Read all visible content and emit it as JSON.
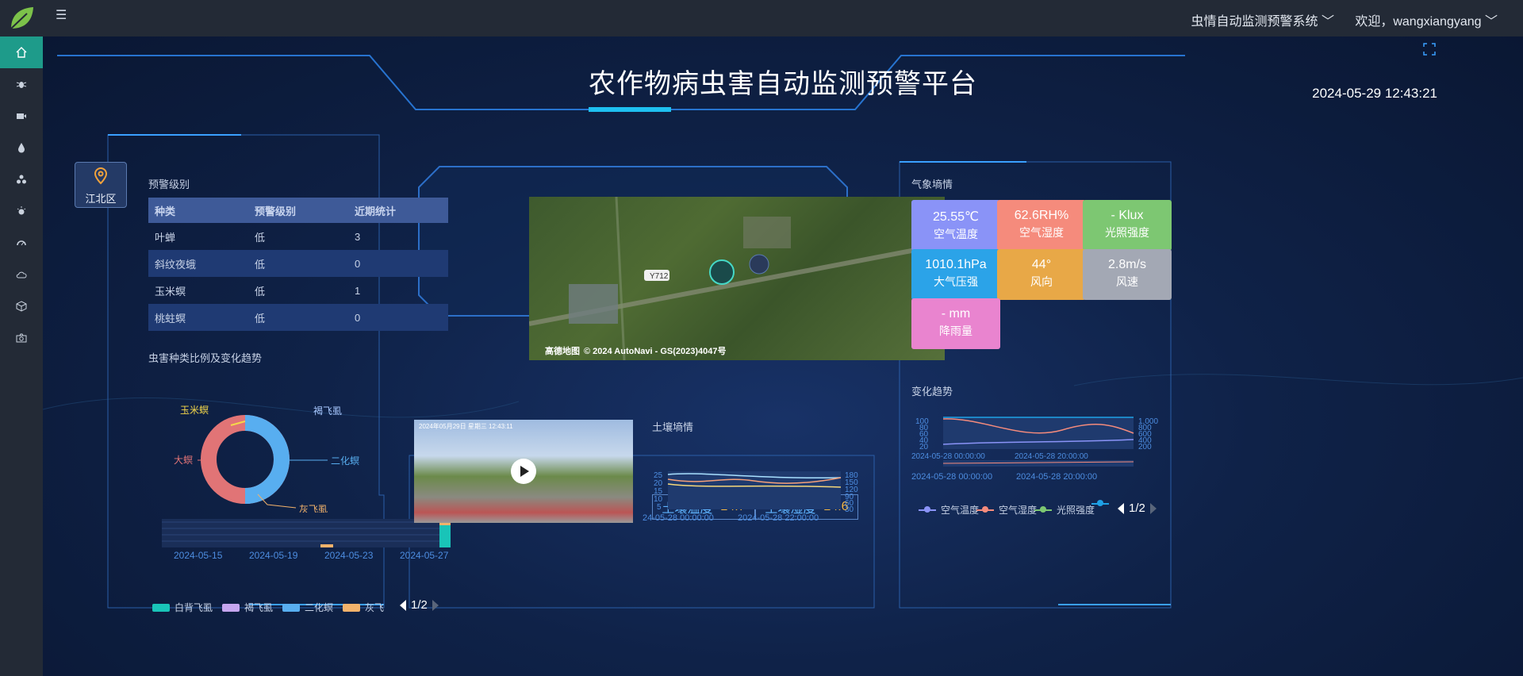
{
  "header": {
    "system_name": "虫情自动监测预警系统 ﹀",
    "welcome": "欢迎，wangxiangyang ﹀"
  },
  "page": {
    "title": "农作物病虫害自动监测预警平台",
    "datetime": "2024-05-29 12:43:21"
  },
  "location": {
    "label": "江北区"
  },
  "warning": {
    "title": "预警级别",
    "columns": [
      "种类",
      "预警级别",
      "近期统计"
    ],
    "rows": [
      {
        "name": "叶蝉",
        "level": "低",
        "count": "3"
      },
      {
        "name": "斜纹夜蛾",
        "level": "低",
        "count": "0"
      },
      {
        "name": "玉米螟",
        "level": "低",
        "count": "1"
      },
      {
        "name": "桃蛀螟",
        "level": "低",
        "count": "0"
      }
    ]
  },
  "pest_chart": {
    "title": "虫害种类比例及变化趋势",
    "legend": [
      "白背飞虱",
      "褐飞虱",
      "二化螟",
      "灰飞"
    ],
    "pager": "1/2",
    "pie_labels": [
      "玉米螟",
      "褐飞虱",
      "大螟",
      "二化螟",
      "灰飞虱"
    ],
    "x_ticks": [
      "2024-05-15",
      "2024-05-19",
      "2024-05-23",
      "2024-05-27"
    ]
  },
  "map": {
    "road_label": "Y712",
    "copyright": "© 2024 AutoNavi - GS(2023)4047号",
    "brand": "高德地图"
  },
  "video": {
    "overlay_text": "2024年05月29日 星期三 12:43:11"
  },
  "soil": {
    "title": "土壤墒情",
    "items": [
      {
        "label": "土壤温度",
        "value": "24.7"
      },
      {
        "label": "土壤湿度",
        "value": "24.6"
      }
    ],
    "x_ticks": [
      "24-05-28 00:00:00",
      "2024-05-28 22:00:00"
    ],
    "y_left": [
      "25",
      "20",
      "15",
      "10",
      "5"
    ],
    "y_right": [
      "180",
      "150",
      "120",
      "90",
      "60",
      "30"
    ]
  },
  "weather": {
    "title": "气象墒情",
    "cards": [
      {
        "value": "25.55℃",
        "label": "空气温度",
        "color": "#8a93f7"
      },
      {
        "value": "62.6RH%",
        "label": "空气湿度",
        "color": "#f58b7c"
      },
      {
        "value": "- Klux",
        "label": "光照强度",
        "color": "#7dc772"
      },
      {
        "value": "1010.1hPa",
        "label": "大气压强",
        "color": "#2ba3e8"
      },
      {
        "value": "44°",
        "label": "风向",
        "color": "#e8a847"
      },
      {
        "value": "2.8m/s",
        "label": "风速",
        "color": "#a3a8b4"
      },
      {
        "value": "- mm",
        "label": "降雨量",
        "color": "#e984cf"
      }
    ]
  },
  "trend": {
    "title": "变化趋势",
    "legend": [
      "空气温度",
      "空气湿度",
      "光照强度",
      ""
    ],
    "legend_colors": [
      "#8a93f7",
      "#f58b7c",
      "#7dc772",
      "#1fa1e6"
    ],
    "pager": "1/2",
    "y_left": [
      "100",
      "80",
      "60",
      "40",
      "20"
    ],
    "y_right": [
      "1,000",
      "800",
      "600",
      "400",
      "200"
    ],
    "x_ticks": [
      "2024-05-28 00:00:00",
      "2024-05-28 20:00:00"
    ],
    "x_ticks_lower": [
      "2024-05-28 00:00:00",
      "2024-05-28 20:00:00"
    ]
  }
}
